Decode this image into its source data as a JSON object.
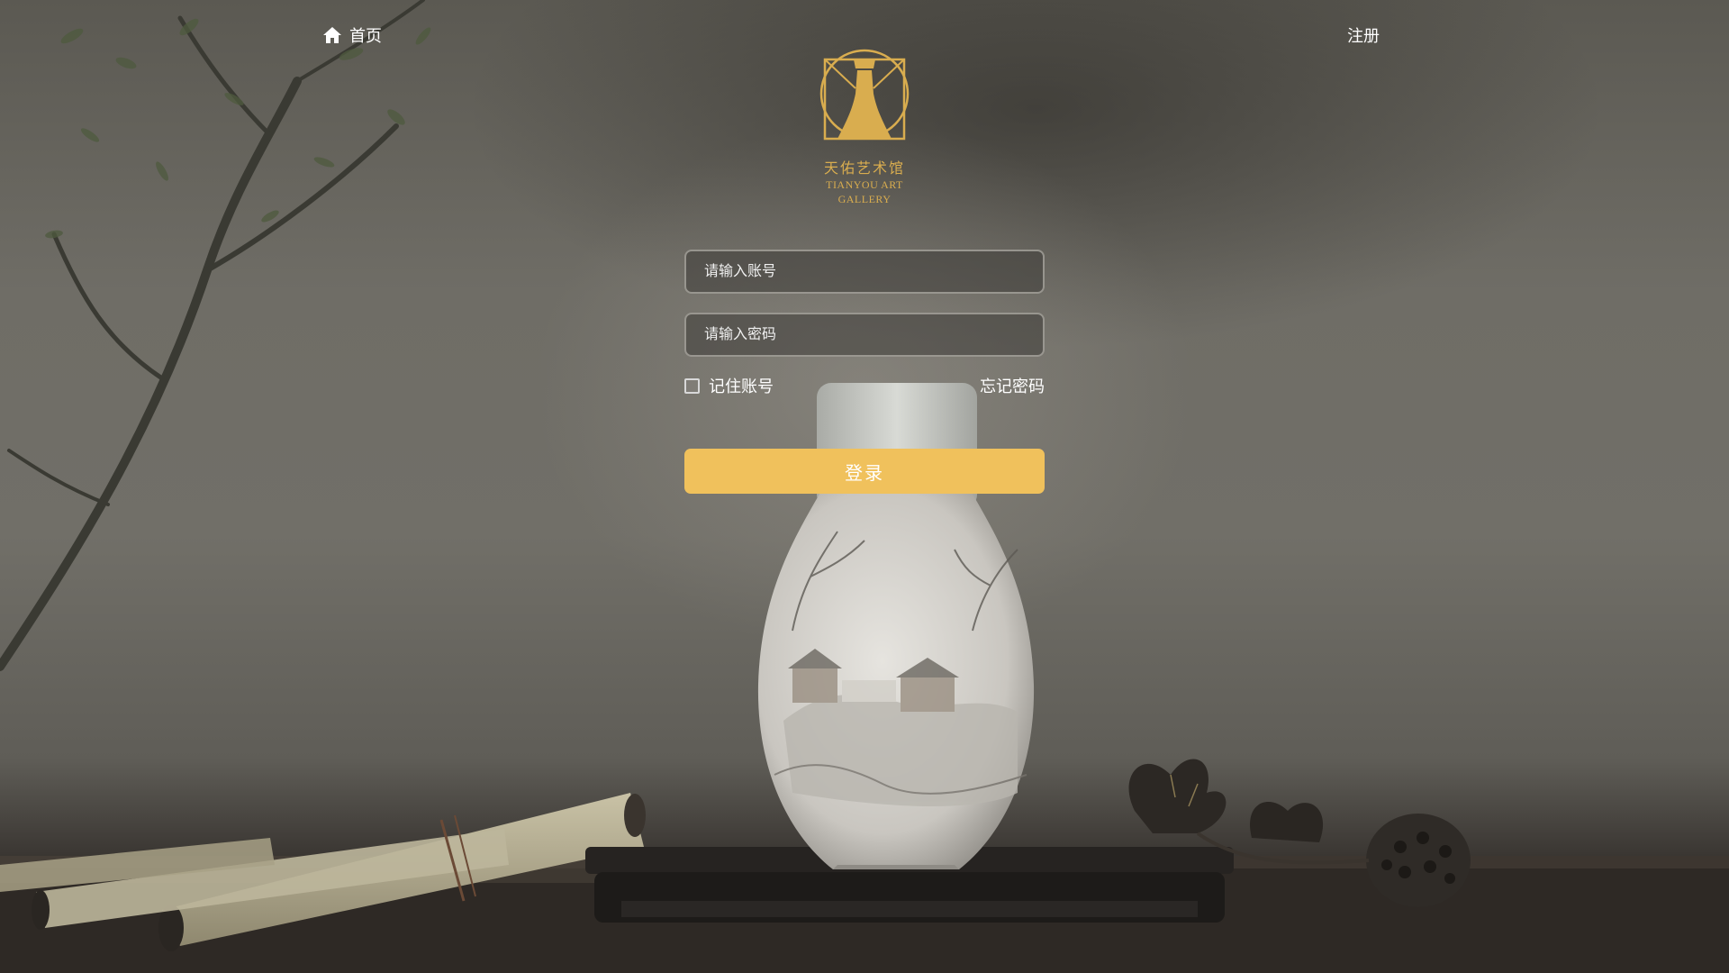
{
  "nav": {
    "home_label": "首页",
    "register_label": "注册"
  },
  "logo": {
    "name_cn": "天佑艺术馆",
    "name_en_line1": "TIANYOU ART",
    "name_en_line2": "GALLERY",
    "color": "#d9ad4f"
  },
  "login_form": {
    "account_placeholder": "请输入账号",
    "password_placeholder": "请输入密码",
    "account_value": "",
    "password_value": "",
    "remember_label": "记住账号",
    "remember_checked": false,
    "forgot_label": "忘记密码",
    "login_button_label": "登录",
    "button_color": "#f0c15c"
  }
}
